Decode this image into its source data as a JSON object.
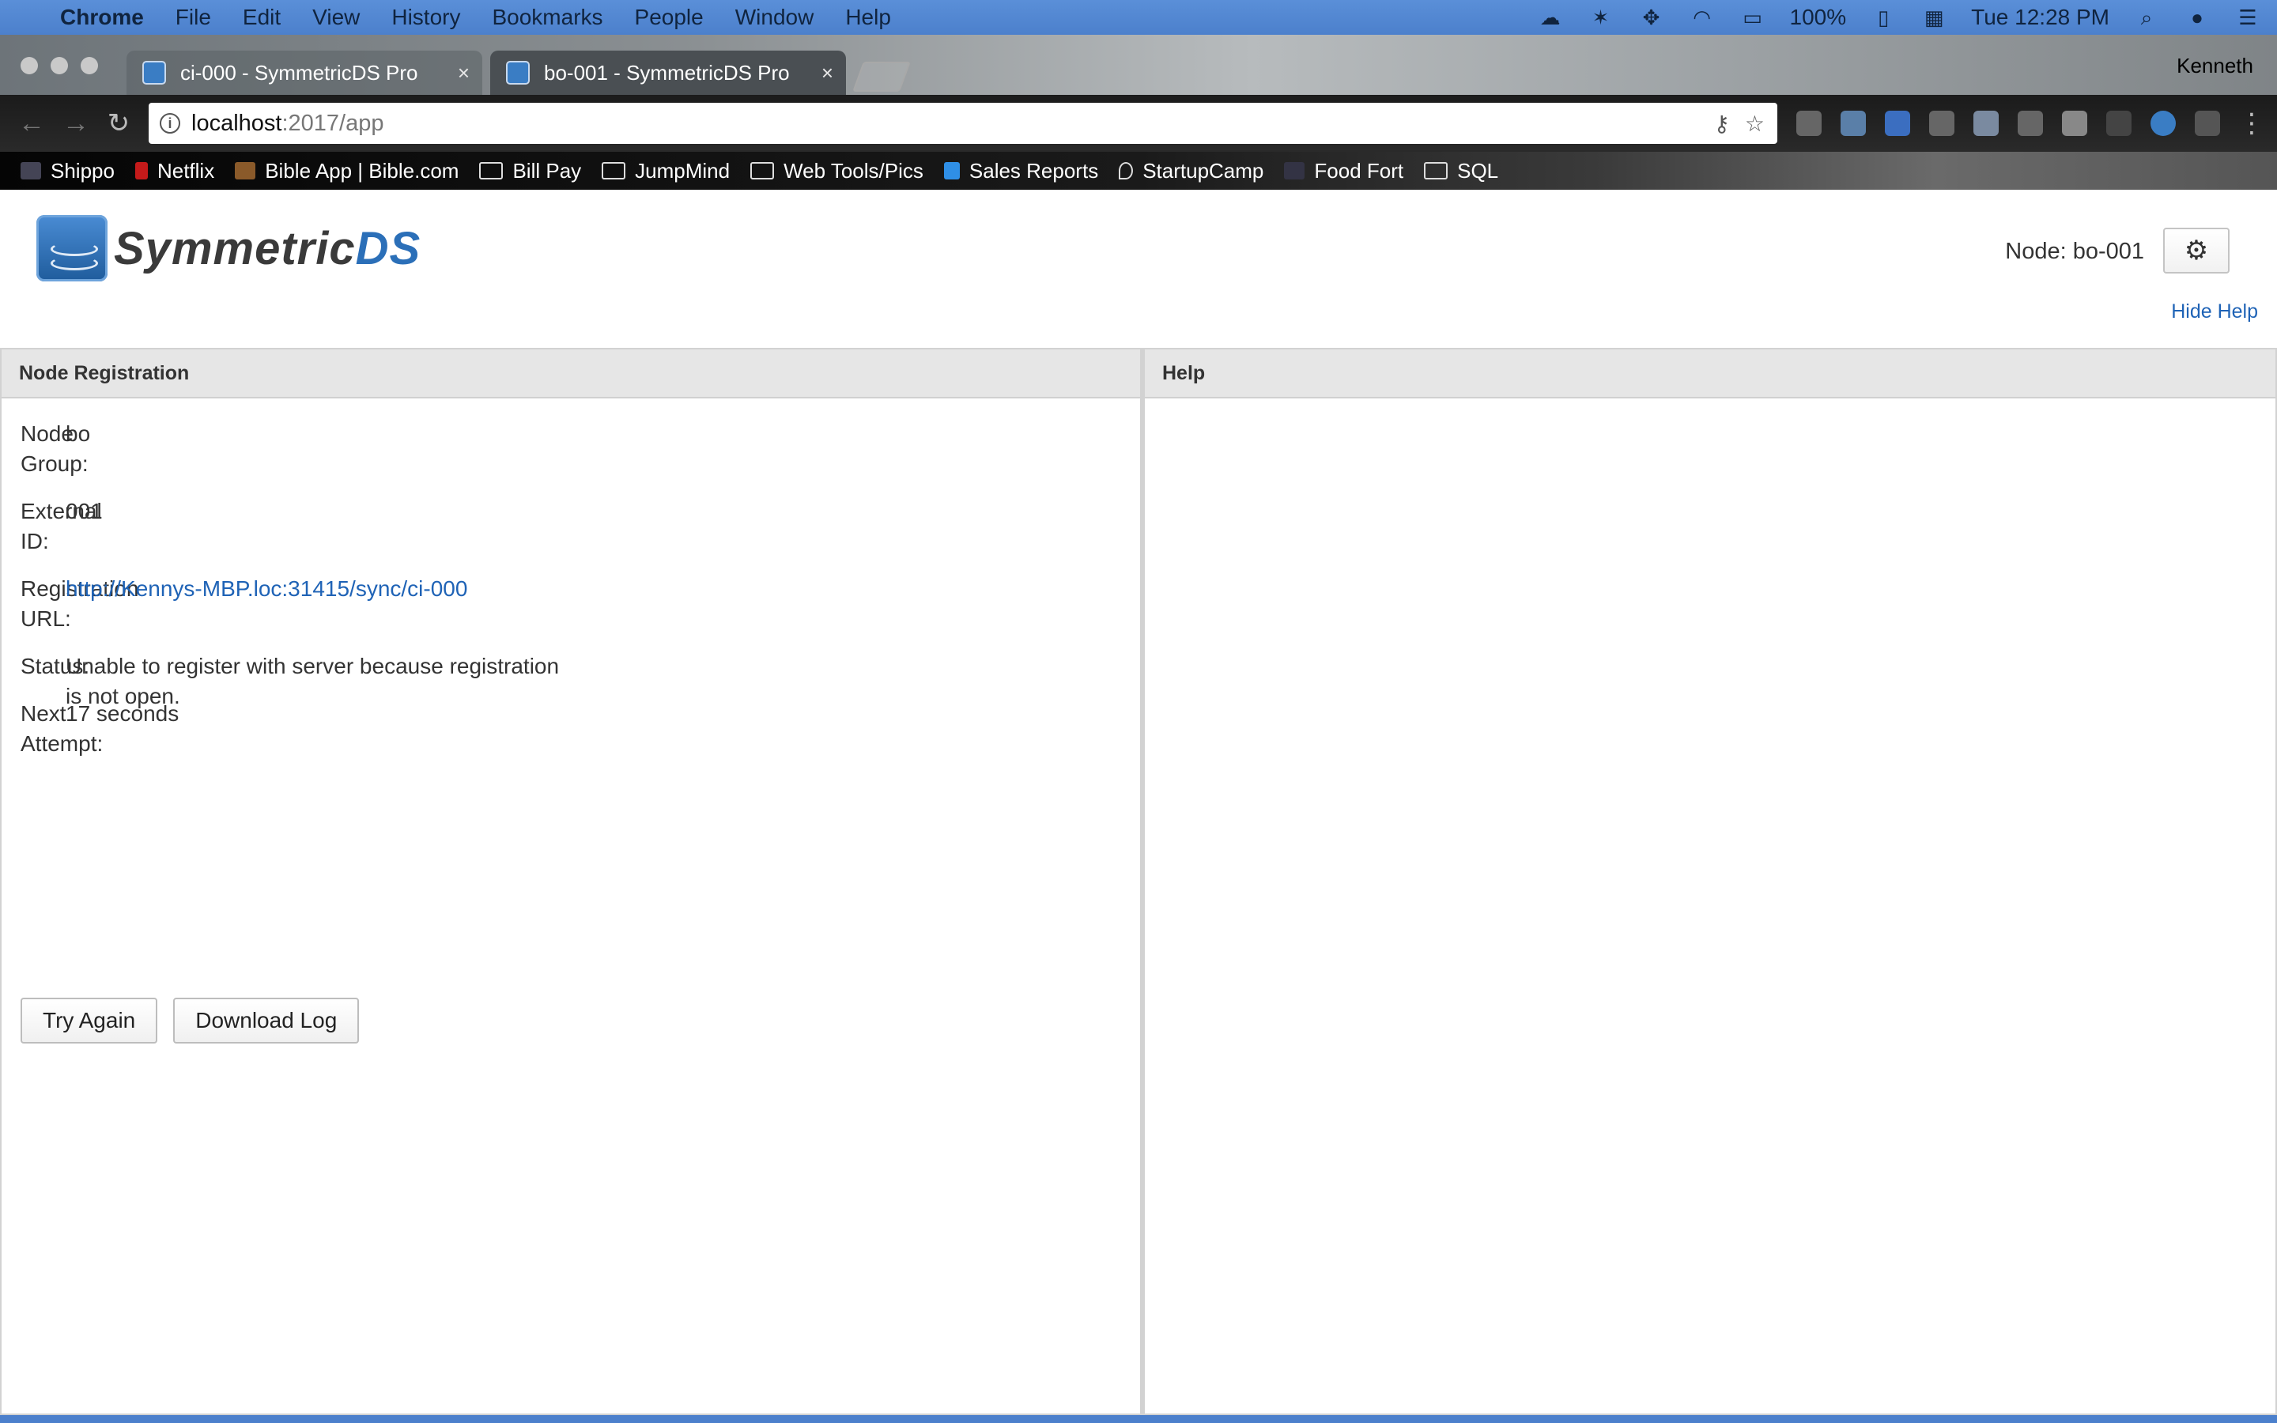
{
  "menubar": {
    "app": "Chrome",
    "items": [
      "File",
      "Edit",
      "View",
      "History",
      "Bookmarks",
      "People",
      "Window",
      "Help"
    ],
    "battery": "100%",
    "clock": "Tue 12:28 PM"
  },
  "tabs": [
    {
      "title": "ci-000 - SymmetricDS Pro",
      "active": false
    },
    {
      "title": "bo-001 - SymmetricDS Pro",
      "active": true
    }
  ],
  "profile_name": "Kenneth",
  "address": {
    "host": "localhost",
    "path": ":2017/app"
  },
  "bookmarks": [
    {
      "label": "Shippo",
      "icon": "shippo-icon"
    },
    {
      "label": "Netflix",
      "icon": "netflix-icon"
    },
    {
      "label": "Bible App | Bible.com",
      "icon": "bible-icon"
    },
    {
      "label": "Bill Pay",
      "icon": "folder-icon"
    },
    {
      "label": "JumpMind",
      "icon": "folder-icon"
    },
    {
      "label": "Web Tools/Pics",
      "icon": "folder-icon"
    },
    {
      "label": "Sales Reports",
      "icon": "phone-icon"
    },
    {
      "label": "StartupCamp",
      "icon": "pin-icon"
    },
    {
      "label": "Food Fort",
      "icon": "food-icon"
    },
    {
      "label": "SQL",
      "icon": "folder-icon"
    }
  ],
  "app": {
    "logo_sym": "Symmetric",
    "logo_ds": "DS",
    "node_label": "Node: bo-001",
    "hide_help": "Hide Help"
  },
  "registration": {
    "header": "Node Registration",
    "node_group_label": "Node Group:",
    "node_group_value": "bo",
    "external_id_label": "External ID:",
    "external_id_value": "001",
    "registration_url_label": "Registration URL:",
    "registration_url_value": "http://Kennys-MBP.loc:31415/sync/ci-000",
    "status_label": "Status:",
    "status_line1": "Unable to register with server because registration",
    "status_line2": "is not open.",
    "next_attempt_label": "Next Attempt:",
    "next_attempt_value": "17 seconds",
    "try_again": "Try Again",
    "download_log": "Download Log"
  },
  "help": {
    "header": "Help"
  },
  "colors": {
    "link": "#1f63b6",
    "menubar": "#4c80cc",
    "logo_blue": "#2b6fb8"
  }
}
